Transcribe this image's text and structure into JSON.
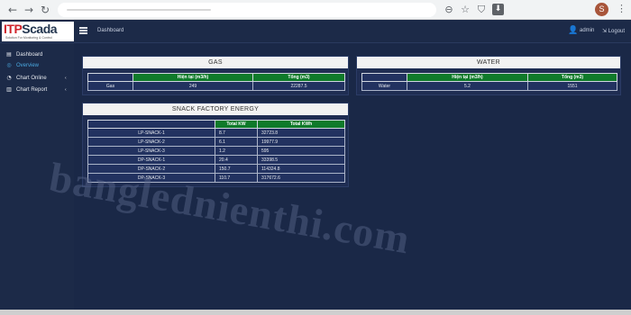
{
  "browser": {
    "back": "←",
    "forward": "→",
    "reload": "↻",
    "zoom_icon": "⊖",
    "star_icon": "☆",
    "shield_icon": "⛉",
    "download_icon": "⬇",
    "profile_initial": "S",
    "menu_icon": "⋮"
  },
  "header": {
    "logo_itp": "ITP",
    "logo_scada": "Scada",
    "logo_sub": "Solution For Monitoring & Control",
    "breadcrumb": "Dashboard",
    "user": "admin",
    "logout": "Logout"
  },
  "sidebar": {
    "items": [
      {
        "label": "Dashboard",
        "icon": "▤"
      },
      {
        "label": "Overview",
        "icon": "◎"
      },
      {
        "label": "Chart Online",
        "icon": "◔",
        "arrow": "‹"
      },
      {
        "label": "Chart Report",
        "icon": "▥",
        "arrow": "‹"
      }
    ]
  },
  "gas": {
    "title": "GAS",
    "headers": [
      "",
      "Hiện tại (m3/h)",
      "Tổng (m3)"
    ],
    "rows": [
      [
        "Gas",
        "249",
        "22287.5"
      ]
    ]
  },
  "water": {
    "title": "WATER",
    "headers": [
      "",
      "Hiện tại (m3/h)",
      "Tổng (m3)"
    ],
    "rows": [
      [
        "Water",
        "5.2",
        "1551"
      ]
    ]
  },
  "snack": {
    "title": "SNACK FACTORY ENERGY",
    "headers": [
      "",
      "Total KW",
      "Total KWh"
    ],
    "rows": [
      [
        "LP-SNACK-1",
        "8.7",
        "32723.8"
      ],
      [
        "LP-SNACK-2",
        "6.1",
        "19977.9"
      ],
      [
        "LP-SNACK-3",
        "1.2",
        "595"
      ],
      [
        "DP-SNACK-1",
        "20.4",
        "33398.5"
      ],
      [
        "DP-SNACK-2",
        "150.7",
        "114324.8"
      ],
      [
        "DP-SNACK-3",
        "110.7",
        "317672.6"
      ]
    ]
  },
  "watermark": "banglednienthi.com"
}
